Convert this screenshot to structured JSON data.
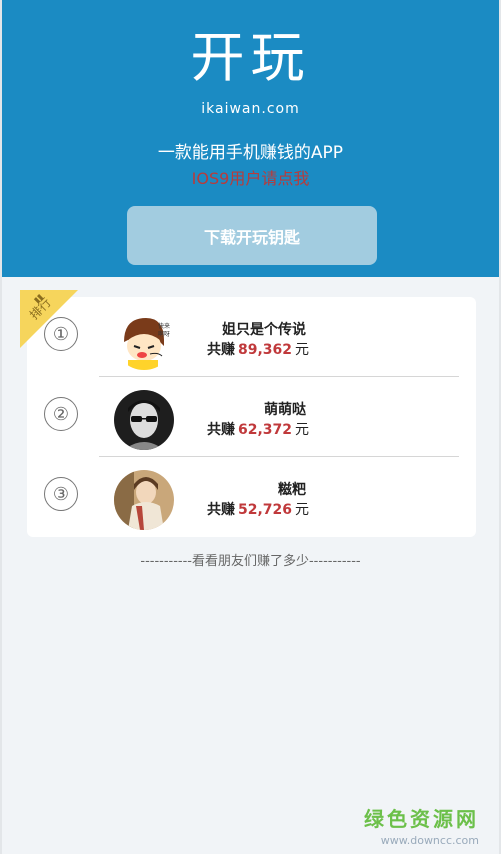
{
  "header": {
    "title": "开玩",
    "domain": "ikaiwan.com",
    "tagline": "一款能用手机赚钱的APP",
    "ios_note": "IOS9用户请点我",
    "download_label": "下载开玩钥匙"
  },
  "ranking": {
    "ribbon_label": "排行",
    "items": [
      {
        "rank": "①",
        "name": "姐只是个传说",
        "earn_label": "共赚",
        "amount": "89,362",
        "unit": "元",
        "avatar": "cartoon-girl-avatar"
      },
      {
        "rank": "②",
        "name": "萌萌哒",
        "earn_label": "共赚",
        "amount": "62,372",
        "unit": "元",
        "avatar": "sunglasses-man-avatar"
      },
      {
        "rank": "③",
        "name": "糍粑",
        "earn_label": "共赚",
        "amount": "52,726",
        "unit": "元",
        "avatar": "scarf-person-avatar"
      }
    ]
  },
  "footer_note": "-----------看看朋友们赚了多少-----------",
  "watermark": {
    "cn": "绿色资源网",
    "en": "www.downcc.com"
  },
  "colors": {
    "header_bg": "#1b8bc3",
    "amount": "#c0393b",
    "ribbon": "#f6d55c"
  }
}
